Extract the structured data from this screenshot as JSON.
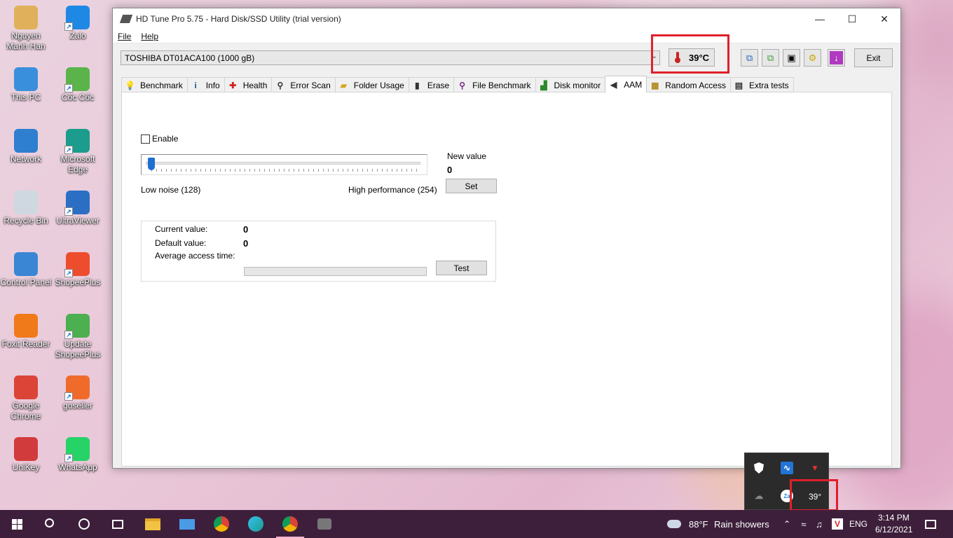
{
  "desktop": {
    "icons": [
      {
        "label": "Nguyen Manh Han",
        "icon": "user-folder-icon",
        "color": "#e0b15a"
      },
      {
        "label": "Zalo",
        "icon": "zalo-icon",
        "color": "#1e88e5"
      },
      {
        "label": "This PC",
        "icon": "computer-icon",
        "color": "#3a8fdc"
      },
      {
        "label": "Cốc Cốc",
        "icon": "coccoc-icon",
        "color": "#5ab44a"
      },
      {
        "label": "Network",
        "icon": "network-icon",
        "color": "#2f7fd0"
      },
      {
        "label": "Microsoft Edge",
        "icon": "edge-icon",
        "color": "#1b9c8c"
      },
      {
        "label": "Recycle Bin",
        "icon": "recycle-bin-icon",
        "color": "#cfd8e0"
      },
      {
        "label": "UltraViewer",
        "icon": "ultraviewer-icon",
        "color": "#2b6fc4"
      },
      {
        "label": "Control Panel",
        "icon": "control-panel-icon",
        "color": "#3a86d4"
      },
      {
        "label": "ShopeePlus",
        "icon": "shopeeplus-icon",
        "color": "#ee4d2d"
      },
      {
        "label": "Foxit Reader",
        "icon": "foxit-reader-icon",
        "color": "#f07a1a"
      },
      {
        "label": "Update ShopeePlus",
        "icon": "update-shopeeplus-icon",
        "color": "#4caf50"
      },
      {
        "label": "Google Chrome",
        "icon": "chrome-icon",
        "color": "#db4437"
      },
      {
        "label": "goseller",
        "icon": "goseller-icon",
        "color": "#f06b2a"
      },
      {
        "label": "UniKey",
        "icon": "unikey-icon",
        "color": "#d23b3b"
      },
      {
        "label": "WhatsApp",
        "icon": "whatsapp-icon",
        "color": "#25d366"
      }
    ]
  },
  "window": {
    "title": "HD Tune Pro 5.75 - Hard Disk/SSD Utility (trial version)",
    "menu": [
      "File",
      "Help"
    ],
    "drive": "TOSHIBA DT01ACA100 (1000 gB)",
    "temperature": "39°C",
    "exit_label": "Exit",
    "tabs": [
      {
        "label": "Benchmark",
        "icon": "lightbulb-icon"
      },
      {
        "label": "Info",
        "icon": "info-icon"
      },
      {
        "label": "Health",
        "icon": "health-cross-icon"
      },
      {
        "label": "Error Scan",
        "icon": "magnifier-icon"
      },
      {
        "label": "Folder Usage",
        "icon": "folder-icon"
      },
      {
        "label": "Erase",
        "icon": "trash-icon"
      },
      {
        "label": "File Benchmark",
        "icon": "file-benchmark-icon"
      },
      {
        "label": "Disk monitor",
        "icon": "disk-monitor-icon"
      },
      {
        "label": "AAM",
        "icon": "speaker-icon"
      },
      {
        "label": "Random Access",
        "icon": "random-access-icon"
      },
      {
        "label": "Extra tests",
        "icon": "extra-tests-icon"
      }
    ],
    "active_tab": "AAM",
    "aam": {
      "enable_label": "Enable",
      "enabled": false,
      "new_value_label": "New value",
      "new_value": "0",
      "set_label": "Set",
      "low_label": "Low noise (128)",
      "high_label": "High performance (254)",
      "slider_min": 128,
      "slider_max": 254,
      "current_label": "Current value:",
      "current_value": "0",
      "default_label": "Default value:",
      "default_value": "0",
      "avg_label": "Average access time:",
      "test_label": "Test"
    }
  },
  "tray_flyout": {
    "temperature": "39°"
  },
  "taskbar": {
    "weather_temp": "88°F",
    "weather_text": "Rain showers",
    "language": "ENG",
    "time": "3:14 PM",
    "date": "6/12/2021"
  },
  "colors": {
    "highlight_red": "#e0202a",
    "taskbar": "#3d1f3b",
    "slider_thumb": "#1f6fd1"
  }
}
